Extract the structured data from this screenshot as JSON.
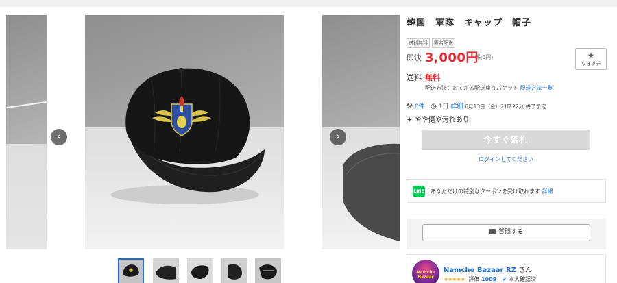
{
  "product": {
    "title": "韓国　軍隊　キャップ　帽子",
    "tags": [
      "送料無料",
      "匿名配送"
    ],
    "price_label": "即決",
    "price": "3,000円",
    "tax_note": "(税0円)",
    "watch_label": "ウォッチ",
    "watch_icon": "star-icon",
    "shipping_label": "送料",
    "shipping_value": "無料",
    "shipping_method_text": "配送方法：おてがる配送ゆうパケット",
    "shipping_method_link": "配送方法一覧",
    "bids_count": "0件",
    "time_left": "1日",
    "detail_link": "詳細",
    "end_time": "6月13日（金）21時22分 終了予定",
    "condition": "やや傷や汚れあり",
    "bid_button": "今すぐ落札",
    "login_link": "ログインしてください"
  },
  "line_promo": {
    "icon_label": "LINE",
    "text": "あなただけの特別なクーポンを受け取れます",
    "link": "詳細"
  },
  "question": {
    "button_label": "質問する"
  },
  "seller": {
    "name": "Namche Bazaar RZ",
    "honorific": "さん",
    "avatar_text": "Namche Bazaar",
    "stars": "★★★★★",
    "rating_label": "評価",
    "rating_count": "1009",
    "verified_label": "本人確認済"
  },
  "carousel": {
    "prev_icon": "chevron-left-icon",
    "next_icon": "chevron-right-icon",
    "prev_glyph": "‹",
    "next_glyph": "›",
    "thumbnail_count": 5,
    "selected_thumbnail": 1
  },
  "colors": {
    "price_red": "#e8282e",
    "link_blue": "#1e6fd9",
    "line_green": "#06c755",
    "star_gold": "#f5a623"
  }
}
